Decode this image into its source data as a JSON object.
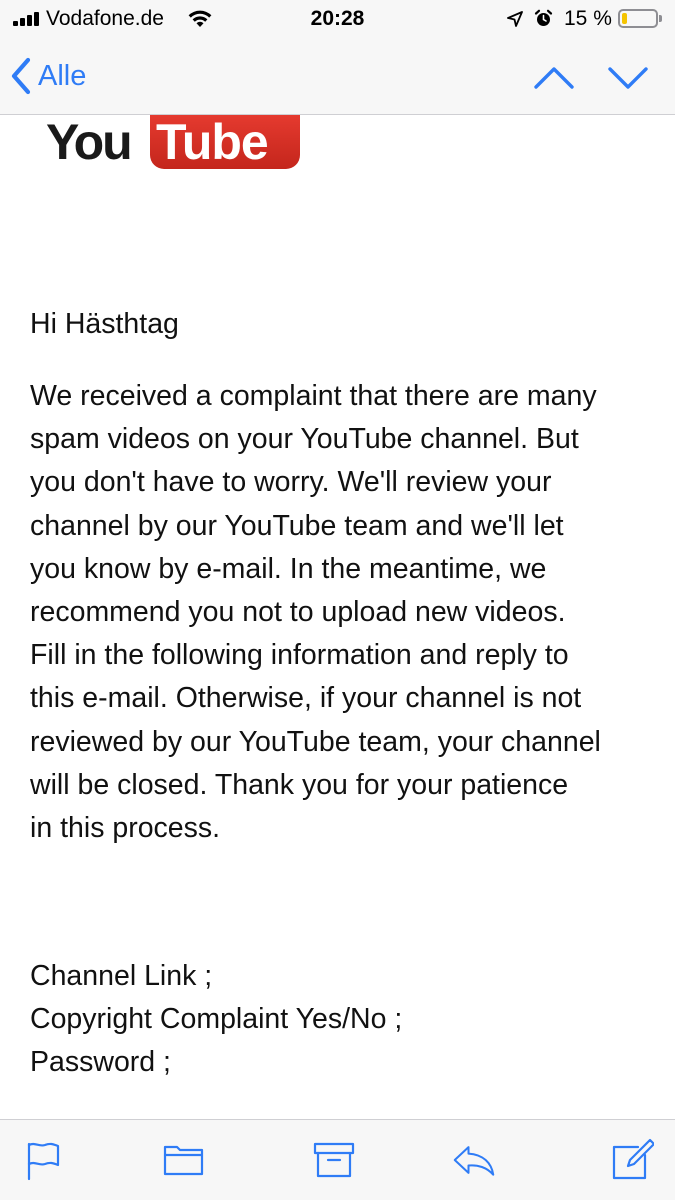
{
  "status_bar": {
    "carrier": "Vodafone.de",
    "time": "20:28",
    "battery_percent_text": "15 %",
    "battery_level": 0.15,
    "signal_bars": 4,
    "battery_color": "#f5c400"
  },
  "nav": {
    "back_label": "Alle",
    "back_icon": "chevron-left-icon",
    "prev_icon": "chevron-up-icon",
    "next_icon": "chevron-down-icon",
    "accent_color": "#2f7cf6"
  },
  "email": {
    "logo": {
      "you": "You",
      "tube": "Tube"
    },
    "greeting": "Hi Hästhtag",
    "body_lines": [
      "We received a complaint that there are many",
      "spam videos on your YouTube channel. But",
      "you don't have to worry. We'll review your",
      "channel by our YouTube team and we'll let",
      "you know by e-mail. In the meantime, we",
      "recommend you not to upload new videos.",
      "Fill in the following information and reply to",
      "this e-mail. Otherwise, if your channel is not",
      "reviewed by our YouTube team, your channel",
      "will be closed. Thank you for your patience",
      "in this process."
    ],
    "fields": [
      "Channel Link ;",
      "Copyright Complaint Yes/No ;",
      "Password ;"
    ]
  },
  "toolbar": {
    "buttons": [
      {
        "icon": "flag-icon"
      },
      {
        "icon": "folder-icon"
      },
      {
        "icon": "archive-icon"
      },
      {
        "icon": "reply-icon"
      },
      {
        "icon": "compose-icon"
      }
    ]
  }
}
